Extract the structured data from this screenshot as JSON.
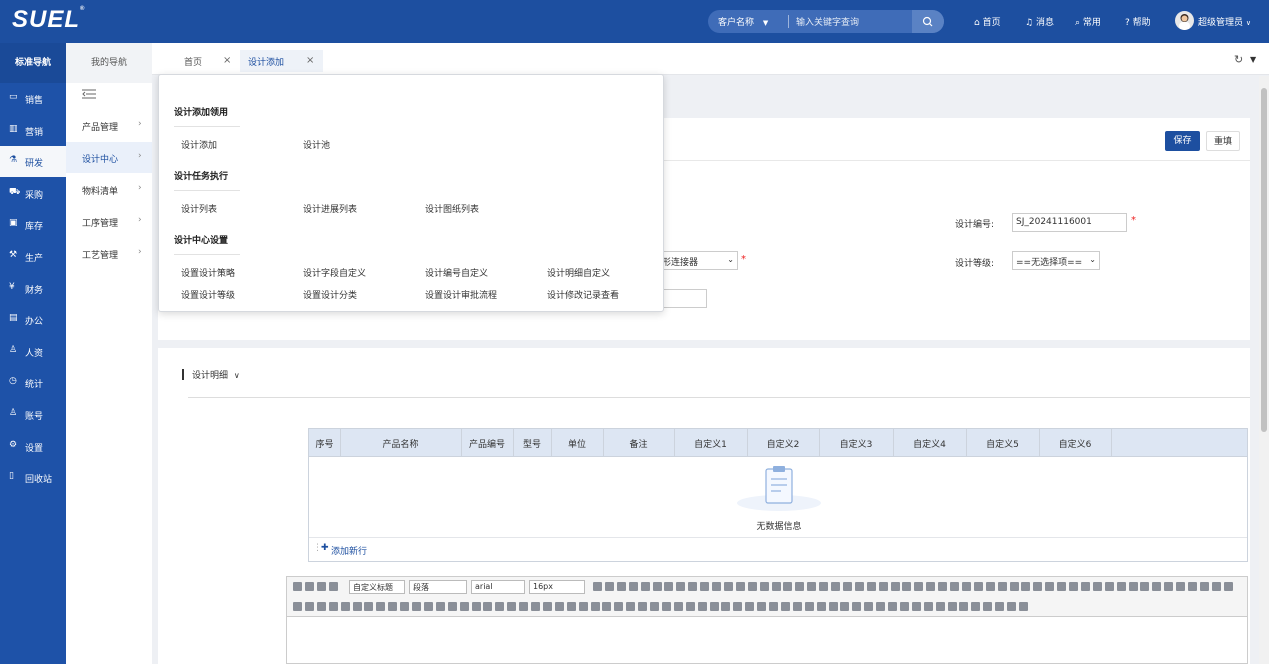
{
  "header": {
    "logo": "SUEL",
    "logo_mark": "®",
    "search_select": "客户名称",
    "search_placeholder": "输入关键字查询",
    "nav": {
      "home": "首页",
      "messages": "消息",
      "common": "常用",
      "help": "帮助",
      "user": "超级管理员"
    }
  },
  "sidebar": {
    "tab_standard": "标准导航",
    "tab_mine": "我的导航",
    "items": [
      {
        "label": "销售",
        "icon": "chat-icon"
      },
      {
        "label": "营销",
        "icon": "bar-chart-icon"
      },
      {
        "label": "研发",
        "icon": "flask-icon"
      },
      {
        "label": "采购",
        "icon": "cart-icon"
      },
      {
        "label": "库存",
        "icon": "box-icon"
      },
      {
        "label": "生产",
        "icon": "factory-icon"
      },
      {
        "label": "财务",
        "icon": "yen-icon"
      },
      {
        "label": "办公",
        "icon": "briefcase-icon"
      },
      {
        "label": "人资",
        "icon": "person-icon"
      },
      {
        "label": "统计",
        "icon": "clock-icon"
      },
      {
        "label": "账号",
        "icon": "user-icon"
      },
      {
        "label": "设置",
        "icon": "gear-icon"
      },
      {
        "label": "回收站",
        "icon": "trash-icon"
      }
    ],
    "active_index": 2
  },
  "subnav": {
    "items": [
      "产品管理",
      "设计中心",
      "物料清单",
      "工序管理",
      "工艺管理"
    ],
    "active_index": 1
  },
  "tabs": [
    {
      "label": "首页"
    },
    {
      "label": "设计添加"
    }
  ],
  "form": {
    "save": "保存",
    "reset": "重填",
    "design_no_label": "设计编号:",
    "design_no_value": "SJ_20241116001",
    "design_level_label": "设计等级:",
    "design_level_value": "==无选择项==",
    "product_select_value": "形连接器"
  },
  "dropdown": {
    "groups": [
      {
        "title": "设计添加领用",
        "items": [
          "设计添加",
          "设计池"
        ]
      },
      {
        "title": "设计任务执行",
        "items": [
          "设计列表",
          "设计进展列表",
          "设计图纸列表"
        ]
      },
      {
        "title": "设计中心设置",
        "items": [
          "设置设计策略",
          "设计字段自定义",
          "设计编号自定义",
          "设计明细自定义",
          "设置设计等级",
          "设置设计分类",
          "设置设计审批流程",
          "设计修改记录查看"
        ]
      }
    ]
  },
  "detail": {
    "title": "设计明细",
    "columns": [
      "序号",
      "产品名称",
      "产品编号",
      "型号",
      "单位",
      "备注",
      "自定义1",
      "自定义2",
      "自定义3",
      "自定义4",
      "自定义5",
      "自定义6"
    ],
    "empty": "无数据信息",
    "add_row": "添加新行"
  },
  "editor": {
    "heading_select": "自定义标题",
    "paragraph_select": "段落",
    "font_select": "arial",
    "size_select": "16px"
  }
}
